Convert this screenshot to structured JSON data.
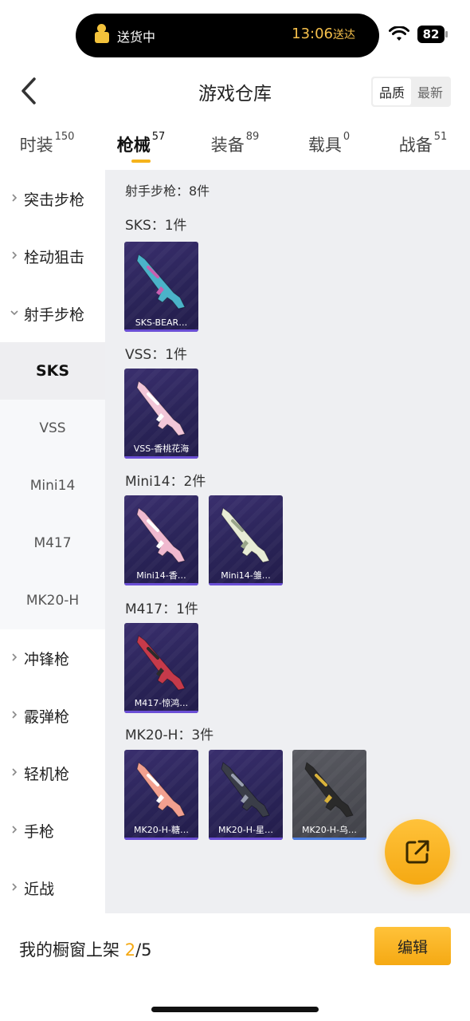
{
  "status_bar": {
    "activity_label": "送货中",
    "eta_time": "13:06",
    "eta_suffix": "送达",
    "battery": "82",
    "icons": [
      "courier-icon",
      "wifi-icon",
      "battery-icon"
    ]
  },
  "header": {
    "title": "游戏仓库",
    "sort_options": [
      "品质",
      "最新"
    ],
    "active_sort": "品质"
  },
  "tabs": [
    {
      "label": "时装",
      "count": "150"
    },
    {
      "label": "枪械",
      "count": "57"
    },
    {
      "label": "装备",
      "count": "89"
    },
    {
      "label": "载具",
      "count": "0"
    },
    {
      "label": "战备",
      "count": "51"
    }
  ],
  "active_tab": "枪械",
  "sidebar": {
    "items": [
      {
        "label": "突击步枪",
        "type": "group",
        "expanded": false
      },
      {
        "label": "栓动狙击",
        "type": "group",
        "expanded": false
      },
      {
        "label": "射手步枪",
        "type": "group",
        "expanded": true
      },
      {
        "label": "SKS",
        "type": "sub",
        "active": true
      },
      {
        "label": "VSS",
        "type": "sub"
      },
      {
        "label": "Mini14",
        "type": "sub"
      },
      {
        "label": "M417",
        "type": "sub"
      },
      {
        "label": "MK20-H",
        "type": "sub"
      },
      {
        "label": "冲锋枪",
        "type": "group",
        "expanded": false
      },
      {
        "label": "霰弹枪",
        "type": "group",
        "expanded": false
      },
      {
        "label": "轻机枪",
        "type": "group",
        "expanded": false
      },
      {
        "label": "手枪",
        "type": "group",
        "expanded": false
      },
      {
        "label": "近战",
        "type": "group",
        "expanded": false
      }
    ]
  },
  "content": {
    "section_title": "射手步枪：8件",
    "categories": [
      {
        "title": "SKS：1件",
        "items": [
          {
            "name": "SKS-BEAR…",
            "color": "#4bb3c9",
            "accent": "#c85fb0"
          }
        ]
      },
      {
        "title": "VSS：1件",
        "items": [
          {
            "name": "VSS-香桃花海",
            "color": "#f2c6d8",
            "accent": "#ffffff"
          }
        ]
      },
      {
        "title": "Mini14：2件",
        "items": [
          {
            "name": "Mini14-香…",
            "color": "#f0b9cf",
            "accent": "#ffffff"
          },
          {
            "name": "Mini14-雏…",
            "color": "#e8ecd6",
            "accent": "#9aa58a"
          }
        ]
      },
      {
        "title": "M417：1件",
        "items": [
          {
            "name": "M417-惊鸿…",
            "color": "#c63a4a",
            "accent": "#2b2b2b"
          }
        ]
      },
      {
        "title": "MK20-H：3件",
        "items": [
          {
            "name": "MK20-H-糖…",
            "color": "#f2a08f",
            "accent": "#ffffff"
          },
          {
            "name": "MK20-H-星…",
            "color": "#3a3d48",
            "accent": "#9aa0b0"
          },
          {
            "name": "MK20-H-乌…",
            "color": "#2a2a2a",
            "accent": "#d9b23a",
            "grey": true
          }
        ]
      }
    ]
  },
  "bottom": {
    "shelf_label": "我的橱窗上架",
    "shelf_count": "2",
    "shelf_total": "/5",
    "edit_label": "编辑"
  },
  "colors": {
    "accent": "#f5a913",
    "card_bg": "#2a2458",
    "content_bg": "#eeeff2"
  }
}
